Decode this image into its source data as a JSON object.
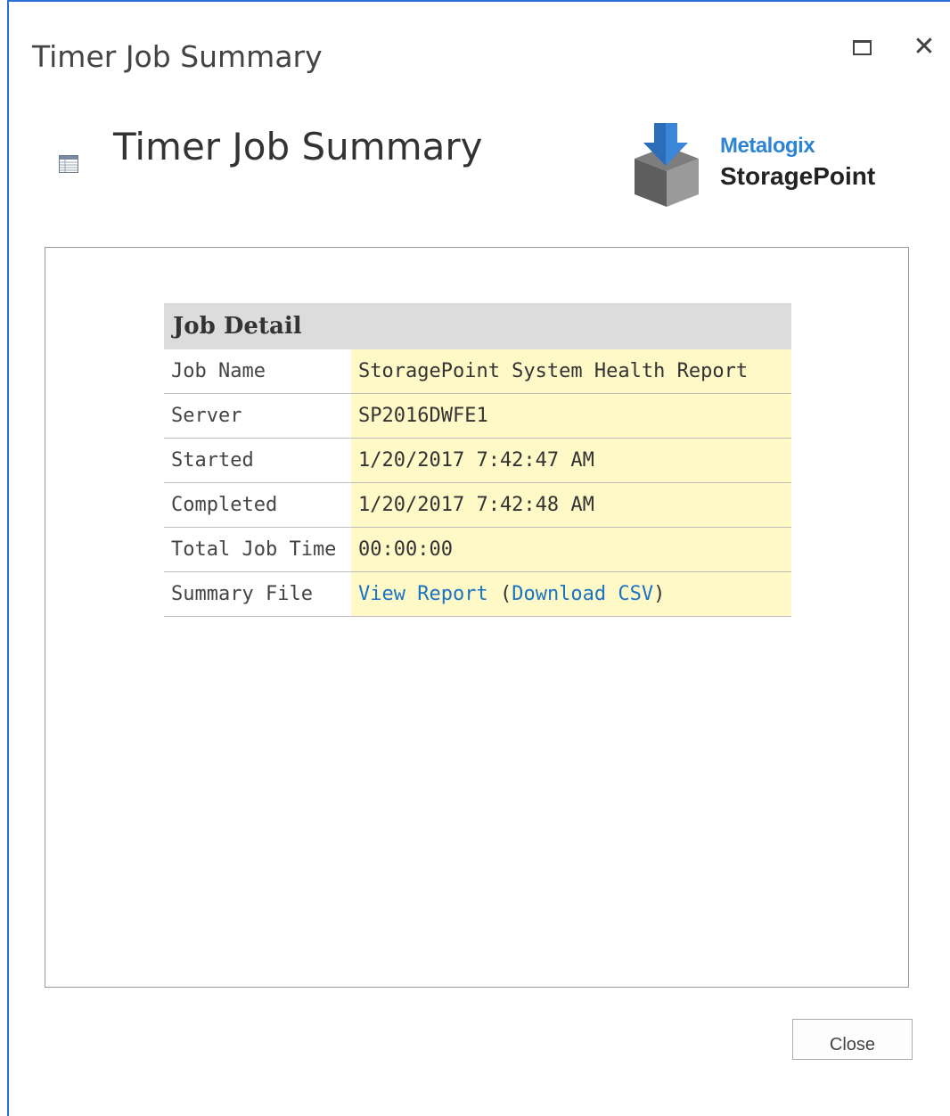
{
  "dialog": {
    "title": "Timer Job Summary",
    "maximize_icon": "maximize-icon",
    "close_icon": "close-icon",
    "close_glyph": "✕"
  },
  "page": {
    "title": "Timer Job Summary",
    "icon": "table-icon"
  },
  "logo": {
    "brand": "Metalogix",
    "product": "StoragePoint",
    "brand_color": "#2e84d0"
  },
  "job_detail": {
    "header": "Job Detail",
    "rows": [
      {
        "label": "Job Name",
        "value": "StoragePoint System Health Report"
      },
      {
        "label": "Server",
        "value": "SP2016DWFE1"
      },
      {
        "label": "Started",
        "value": "1/20/2017 7:42:47 AM"
      },
      {
        "label": "Completed",
        "value": "1/20/2017 7:42:48 AM"
      },
      {
        "label": "Total Job Time",
        "value": "00:00:00"
      }
    ],
    "summary_file": {
      "label": "Summary File",
      "view_report": "View Report",
      "open_paren": " (",
      "download_csv": "Download CSV",
      "close_paren": ")"
    },
    "value_background": "#fff9c8",
    "header_background": "#dcdcdc",
    "link_color": "#1a73c4"
  },
  "footer": {
    "close_label": "Close"
  }
}
